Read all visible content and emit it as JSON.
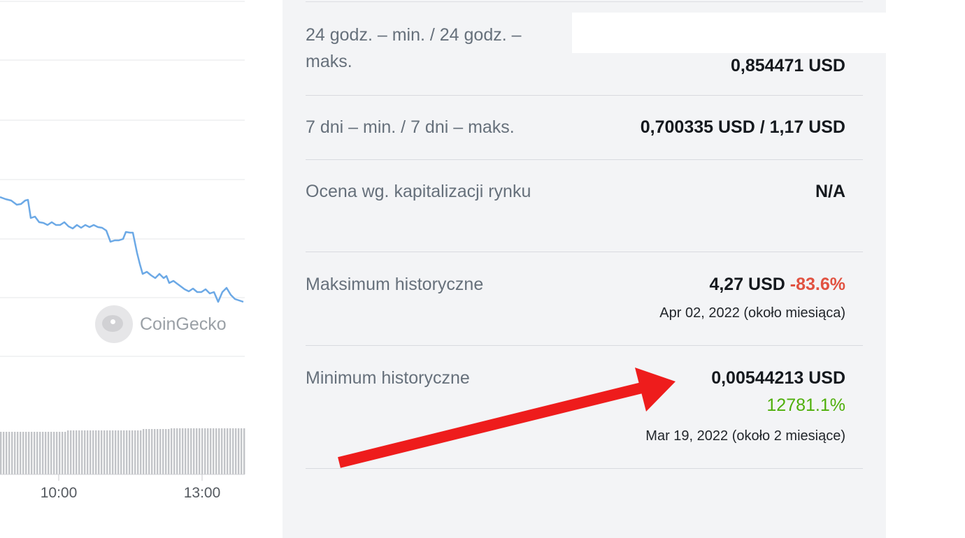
{
  "chart": {
    "watermark": "CoinGecko",
    "x_ticks": [
      "10:00",
      "13:00"
    ],
    "line_color": "#6ca9e6",
    "volume_color": "#c2c4c8"
  },
  "stats": {
    "range_24h": {
      "label": "24 godz. – min. / 24 godz. – maks.",
      "value": "0,854471 USD"
    },
    "range_7d": {
      "label": "7 dni – min. / 7 dni – maks.",
      "value": "0,700335 USD / 1,17 USD"
    },
    "market_cap_rank": {
      "label": "Ocena wg. kapitalizacji rynku",
      "value": "N/A"
    },
    "ath": {
      "label": "Maksimum historyczne",
      "value": "4,27 USD",
      "change": "-83.6%",
      "date": "Apr 02, 2022 (około miesiąca)"
    },
    "atl": {
      "label": "Minimum historyczne",
      "value": "0,00544213 USD",
      "change": "12781.1%",
      "date": "Mar 19, 2022 (około 2 miesiące)"
    }
  },
  "colors": {
    "negative": "#e15241",
    "positive": "#4eaf0a",
    "annotation_arrow": "#ee1c1c"
  }
}
